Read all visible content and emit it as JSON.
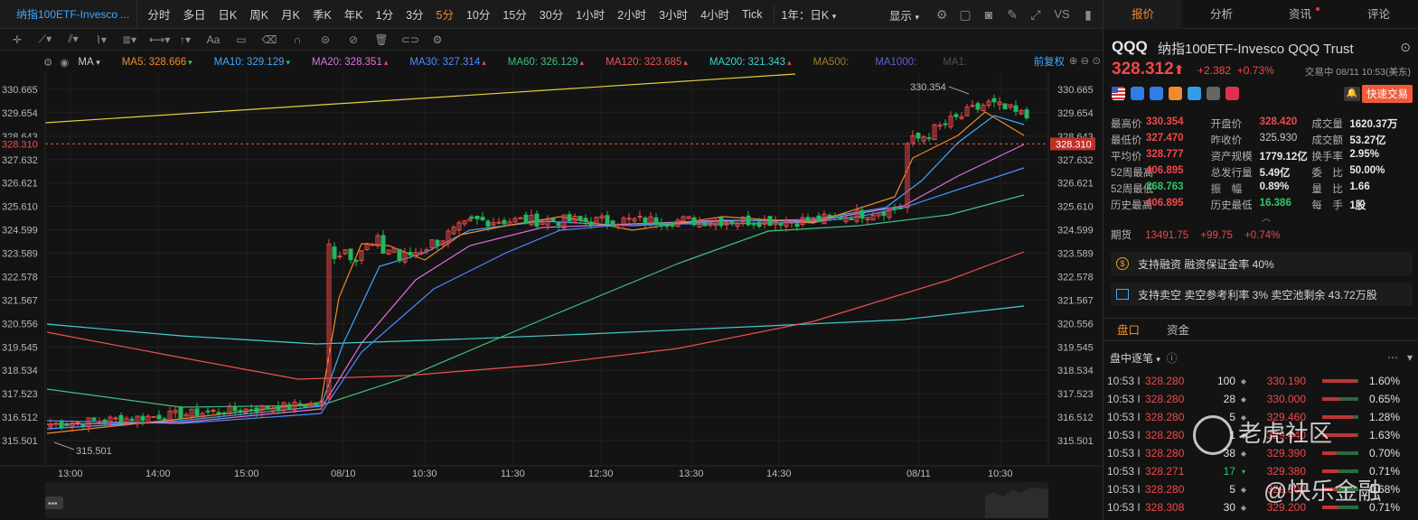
{
  "toolbar": {
    "symbol_tab": "纳指100ETF-Invesco ...",
    "periods": [
      "分时",
      "多日",
      "日K",
      "周K",
      "月K",
      "季K",
      "年K",
      "1分",
      "3分",
      "5分",
      "10分",
      "15分",
      "30分",
      "1小时",
      "2小时",
      "3小时",
      "4小时",
      "Tick"
    ],
    "active_period": "5分",
    "preset": "1年：日K",
    "display": "显示",
    "vs": "VS"
  },
  "ma_bar": {
    "indicator": "MA",
    "items": [
      {
        "label": "MA5:",
        "value": "328.666",
        "arrow": "▾",
        "color": "#f08a2c"
      },
      {
        "label": "MA10:",
        "value": "329.129",
        "arrow": "▾",
        "color": "#3ea8ff"
      },
      {
        "label": "MA20:",
        "value": "328.351",
        "arrow": "▴",
        "color": "#e070e0"
      },
      {
        "label": "MA30:",
        "value": "327.314",
        "arrow": "▴",
        "color": "#4c8cff"
      },
      {
        "label": "MA60:",
        "value": "326.129",
        "arrow": "▴",
        "color": "#40c080"
      },
      {
        "label": "MA120:",
        "value": "323.685",
        "arrow": "▴",
        "color": "#f05050"
      },
      {
        "label": "MA200:",
        "value": "321.343",
        "arrow": "▴",
        "color": "#40d0d0"
      },
      {
        "label": "MA500:",
        "value": "",
        "arrow": "",
        "color": "#a08020"
      },
      {
        "label": "MA1000:",
        "value": "",
        "arrow": "",
        "color": "#6060d0"
      },
      {
        "label": "MA1:",
        "value": "",
        "arrow": "",
        "color": "#505050"
      }
    ],
    "adjust": "前复权"
  },
  "chart_data": {
    "type": "candlestick",
    "y_ticks": [
      "330.665",
      "329.654",
      "328.643",
      "327.632",
      "326.621",
      "325.610",
      "324.599",
      "323.589",
      "322.578",
      "321.567",
      "320.556",
      "319.545",
      "318.534",
      "317.523",
      "316.512",
      "315.501"
    ],
    "ylim": [
      315.501,
      330.665
    ],
    "x_ticks": [
      "13:00",
      "14:00",
      "15:00",
      "08/10",
      "10:30",
      "11:30",
      "12:30",
      "13:30",
      "14:30",
      "08/11",
      "10:30"
    ],
    "last_price_line": "328.310",
    "high_marker": "330.354",
    "low_marker": "315.501"
  },
  "quote": {
    "ticker": "QQQ",
    "name": "纳指100ETF-Invesco QQQ Trust",
    "price": "328.312",
    "arrow": "⬆",
    "change": "+2.382",
    "change_pct": "+0.73%",
    "status": "交易中 08/11 10:53(美东)",
    "fast_trade": "快速交易"
  },
  "tabs": [
    "报价",
    "分析",
    "资讯",
    "评论"
  ],
  "stats": [
    [
      {
        "k": "最高价",
        "v": "330.354",
        "c": "red"
      },
      {
        "k": "开盘价",
        "v": "328.420",
        "c": "red"
      },
      {
        "k": "成交量",
        "v": "1620.37万",
        "c": "white"
      }
    ],
    [
      {
        "k": "最低价",
        "v": "327.470",
        "c": "red"
      },
      {
        "k": "昨收价",
        "v": "325.930",
        "c": "gray"
      },
      {
        "k": "成交额",
        "v": "53.27亿",
        "c": "white"
      }
    ],
    [
      {
        "k": "平均价",
        "v": "328.777",
        "c": "red"
      },
      {
        "k": "资产规模",
        "v": "1779.12亿",
        "c": "white"
      },
      {
        "k": "换手率",
        "v": "2.95%",
        "c": "white"
      }
    ],
    [
      {
        "k": "52周最高",
        "v": "406.895",
        "c": "red"
      },
      {
        "k": "总发行量",
        "v": "5.49亿",
        "c": "white"
      },
      {
        "k": "委　比",
        "v": "50.00%",
        "c": "white"
      }
    ],
    [
      {
        "k": "52周最低",
        "v": "268.763",
        "c": "green"
      },
      {
        "k": "振　幅",
        "v": "0.89%",
        "c": "white"
      },
      {
        "k": "量　比",
        "v": "1.66",
        "c": "white"
      }
    ],
    [
      {
        "k": "历史最高",
        "v": "406.895",
        "c": "red"
      },
      {
        "k": "历史最低",
        "v": "16.386",
        "c": "green"
      },
      {
        "k": "每　手",
        "v": "1股",
        "c": "white"
      }
    ]
  ],
  "futures": {
    "label": "期货",
    "value": "13491.75",
    "change": "+99.75",
    "pct": "+0.74%"
  },
  "info1": "支持融资 融资保证金率 40%",
  "info2": "支持卖空 卖空参考利率 3% 卖空池剩余 43.72万股",
  "subtabs": [
    "盘口",
    "资金"
  ],
  "tick_header": "盘中逐笔",
  "ticks": [
    {
      "t": "10:53 I",
      "p1": "328.280",
      "q": "100",
      "ar": "◆",
      "p2": "330.190",
      "pct": "1.60%",
      "qc": "white"
    },
    {
      "t": "10:53 I",
      "p1": "328.280",
      "q": "28",
      "ar": "◆",
      "p2": "330.000",
      "pct": "0.65%",
      "qc": "white"
    },
    {
      "t": "10:53 I",
      "p1": "328.280",
      "q": "5",
      "ar": "◆",
      "p2": "329.460",
      "pct": "1.28%",
      "qc": "white"
    },
    {
      "t": "10:53 I",
      "p1": "328.280",
      "q": "1",
      "ar": "◆",
      "p2": "329.440",
      "pct": "1.63%",
      "qc": "white"
    },
    {
      "t": "10:53 I",
      "p1": "328.280",
      "q": "38",
      "ar": "◆",
      "p2": "329.390",
      "pct": "0.70%",
      "qc": "white"
    },
    {
      "t": "10:53 I",
      "p1": "328.271",
      "q": "17",
      "ar": "▾",
      "p2": "329.380",
      "pct": "0.71%",
      "qc": "green"
    },
    {
      "t": "10:53 I",
      "p1": "328.280",
      "q": "5",
      "ar": "◆",
      "p2": "329.300",
      "pct": "0.68%",
      "qc": "white"
    },
    {
      "t": "10:53 I",
      "p1": "328.308",
      "q": "30",
      "ar": "◆",
      "p2": "329.200",
      "pct": "0.71%",
      "qc": "white"
    }
  ],
  "watermark1": "老虎社区",
  "watermark2": "@快乐金融"
}
